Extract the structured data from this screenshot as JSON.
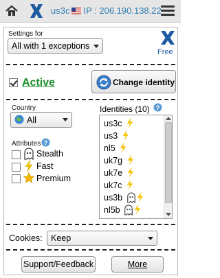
{
  "topbar": {
    "country_code": "us3c",
    "ip_prefix": "IP : ",
    "ip_address": "206.190.138.22"
  },
  "settings": {
    "label": "Settings for",
    "selected": "All with 1 exceptions",
    "plan": "Free"
  },
  "status": {
    "active_label": "Active",
    "active_checked": true,
    "change_identity_label": "Change identity"
  },
  "country": {
    "label": "Country",
    "selected": "All"
  },
  "attributes": {
    "label": "Attributes",
    "items": [
      {
        "label": "Stealth",
        "checked": false,
        "icon": "ghost-icon"
      },
      {
        "label": "Fast",
        "checked": false,
        "icon": "lightning-icon"
      },
      {
        "label": "Premium",
        "checked": false,
        "icon": "star-icon"
      }
    ]
  },
  "identities": {
    "label": "Identities (10)",
    "items": [
      {
        "name": "us3c",
        "icons": [
          "lightning-icon"
        ]
      },
      {
        "name": "us3",
        "icons": [
          "lightning-icon"
        ]
      },
      {
        "name": "nl5",
        "icons": [
          "lightning-icon"
        ]
      },
      {
        "name": "uk7g",
        "icons": [
          "lightning-icon"
        ]
      },
      {
        "name": "uk7e",
        "icons": [
          "lightning-icon"
        ]
      },
      {
        "name": "uk7c",
        "icons": [
          "lightning-icon"
        ]
      },
      {
        "name": "us3b",
        "icons": [
          "ghost-icon",
          "lightning-icon"
        ]
      },
      {
        "name": "nl5b",
        "icons": [
          "ghost-icon",
          "lightning-icon"
        ]
      }
    ]
  },
  "cookies": {
    "label": "Cookies:",
    "selected": "Keep"
  },
  "footer": {
    "support_label": "Support/Feedback",
    "more_label": "More"
  },
  "colors": {
    "accent": "#1e5ba0",
    "active_green": "#1b8c2a",
    "ip_text": "#2f7fb4",
    "lightning": "#f2c200"
  }
}
